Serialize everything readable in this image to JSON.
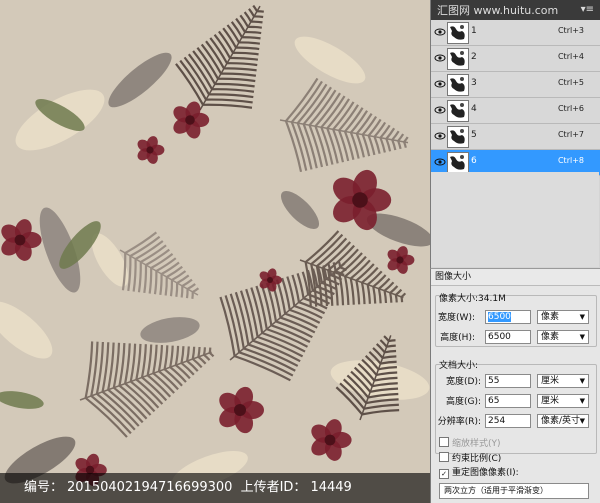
{
  "canvas": {
    "background_color": "#d3c9b9"
  },
  "footer": {
    "serial_label": "编号：",
    "serial": "20150402194716699300",
    "uploader_label": "上传者ID：",
    "uploader": "14449"
  },
  "watermark": "汇图网 www.huitu.com",
  "channels": [
    {
      "name": "1",
      "shortcut": "Ctrl+3",
      "active": false
    },
    {
      "name": "2",
      "shortcut": "Ctrl+4",
      "active": false
    },
    {
      "name": "3",
      "shortcut": "Ctrl+5",
      "active": false
    },
    {
      "name": "4",
      "shortcut": "Ctrl+6",
      "active": false
    },
    {
      "name": "5",
      "shortcut": "Ctrl+7",
      "active": false
    },
    {
      "name": "6",
      "shortcut": "Ctrl+8",
      "active": true
    }
  ],
  "dialog": {
    "title": "图像大小",
    "pixel_size_label": "像素大小:34.1M",
    "width_label": "宽度(W):",
    "width_value": "6500",
    "width_unit": "像素",
    "height_label": "高度(H):",
    "height_value": "6500",
    "height_unit": "像素",
    "doc_size_label": "文档大小:",
    "doc_width_label": "宽度(D):",
    "doc_width_value": "55",
    "doc_width_unit": "厘米",
    "doc_height_label": "高度(G):",
    "doc_height_value": "65",
    "doc_height_unit": "厘米",
    "resolution_label": "分辨率(R):",
    "resolution_value": "254",
    "resolution_unit": "像素/英寸",
    "scale_styles_label": "缩放样式(Y)",
    "constrain_label": "约束比例(C)",
    "resample_label": "重定图像像素(I):",
    "resample_method": "两次立方（适用于平滑渐变）"
  }
}
